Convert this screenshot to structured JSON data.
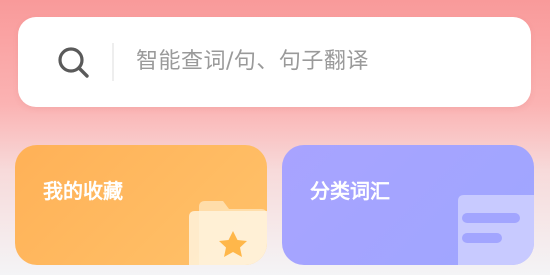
{
  "search": {
    "placeholder": "智能查词/句、句子翻译",
    "icon": "search-icon"
  },
  "cards": [
    {
      "label": "我的收藏",
      "icon": "folder-star-icon",
      "color": "#ffb75e"
    },
    {
      "label": "分类词汇",
      "icon": "document-list-icon",
      "color": "#a6a6ff"
    }
  ]
}
